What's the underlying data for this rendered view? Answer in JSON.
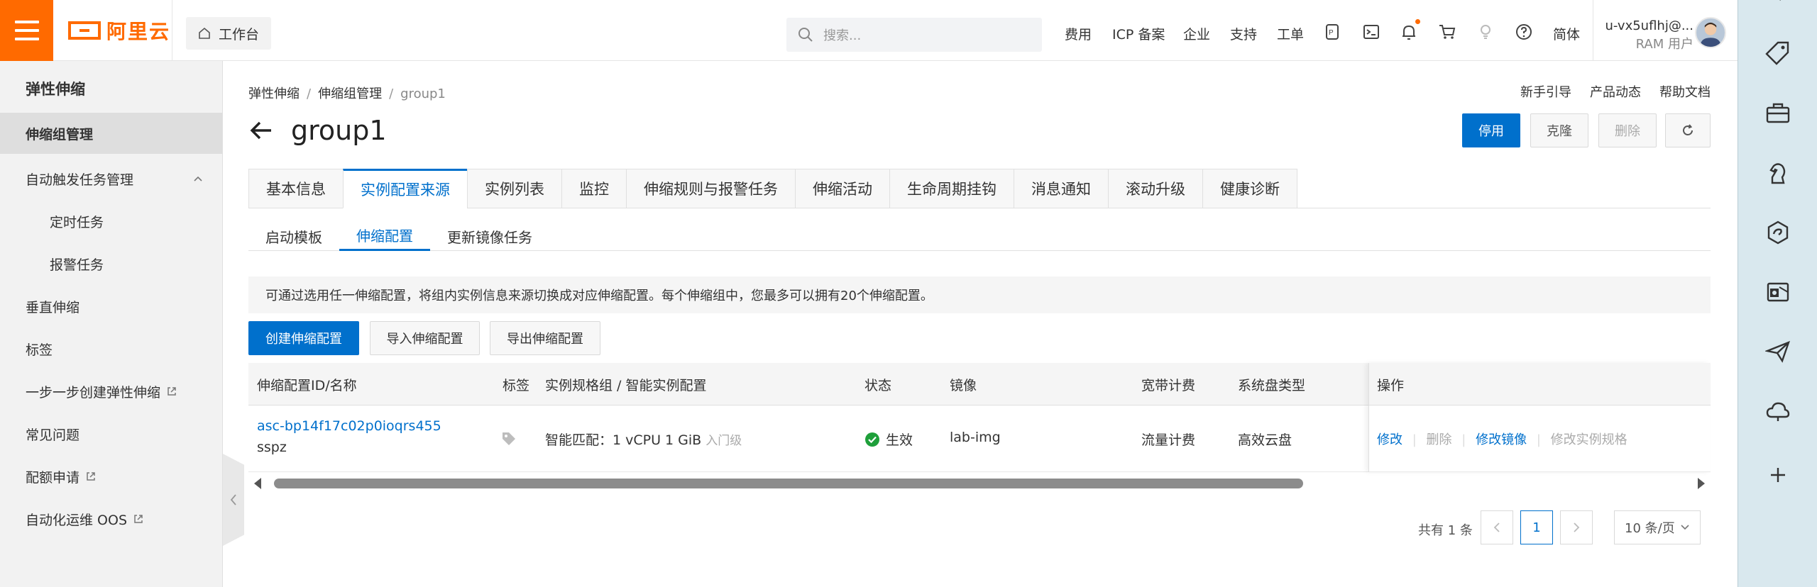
{
  "topbar": {
    "logo_text": "阿里云",
    "workbench": "工作台",
    "search_placeholder": "搜索...",
    "nav": [
      "费用",
      "ICP 备案",
      "企业",
      "支持",
      "工单"
    ],
    "lang": "简体",
    "user_name": "u-vx5uflhj@...",
    "user_role": "RAM 用户"
  },
  "sidebar": {
    "title": "弹性伸缩",
    "items": [
      {
        "label": "伸缩组管理",
        "active": true
      },
      {
        "label": "自动触发任务管理"
      },
      {
        "label": "定时任务"
      },
      {
        "label": "报警任务"
      },
      {
        "label": "垂直伸缩"
      },
      {
        "label": "标签"
      },
      {
        "label": "一步一步创建弹性伸缩"
      },
      {
        "label": "常见问题"
      },
      {
        "label": "配额申请"
      },
      {
        "label": "自动化运维 OOS"
      }
    ]
  },
  "breadcrumb": [
    "弹性伸缩",
    "伸缩组管理",
    "group1"
  ],
  "help_links": [
    "新手引导",
    "产品动态",
    "帮助文档"
  ],
  "page": {
    "title": "group1",
    "actions": [
      "停用",
      "克隆",
      "删除"
    ]
  },
  "tabs": [
    "基本信息",
    "实例配置来源",
    "实例列表",
    "监控",
    "伸缩规则与报警任务",
    "伸缩活动",
    "生命周期挂钩",
    "消息通知",
    "滚动升级",
    "健康诊断"
  ],
  "active_tab": "实例配置来源",
  "subtabs": [
    "启动模板",
    "伸缩配置",
    "更新镜像任务"
  ],
  "active_subtab": "伸缩配置",
  "notice": "可通过选用任一伸缩配置，将组内实例信息来源切换成对应伸缩配置。每个伸缩组中，您最多可以拥有20个伸缩配置。",
  "buttons": {
    "create": "创建伸缩配置",
    "import": "导入伸缩配置",
    "export": "导出伸缩配置"
  },
  "table": {
    "headers": [
      "伸缩配置ID/名称",
      "标签",
      "实例规格组 / 智能实例配置",
      "状态",
      "镜像",
      "宽带计费",
      "系统盘类型",
      "操作"
    ],
    "rows": [
      {
        "id": "asc-bp14f17c02p0ioqrs455",
        "name": "sspz",
        "spec": "智能匹配：1 vCPU 1 GiB",
        "spec_level": "入门级",
        "status": "生效",
        "image": "lab-img",
        "billing": "流量计费",
        "disk": "高效云盘",
        "ops": [
          "修改",
          "删除",
          "修改镜像",
          "修改实例规格"
        ]
      }
    ]
  },
  "pagination": {
    "total": "共有 1 条",
    "current": "1",
    "page_size": "10 条/页"
  },
  "colors": {
    "brand": "#ff6a00",
    "primary": "#0070cc",
    "success": "#1e9f3a"
  }
}
